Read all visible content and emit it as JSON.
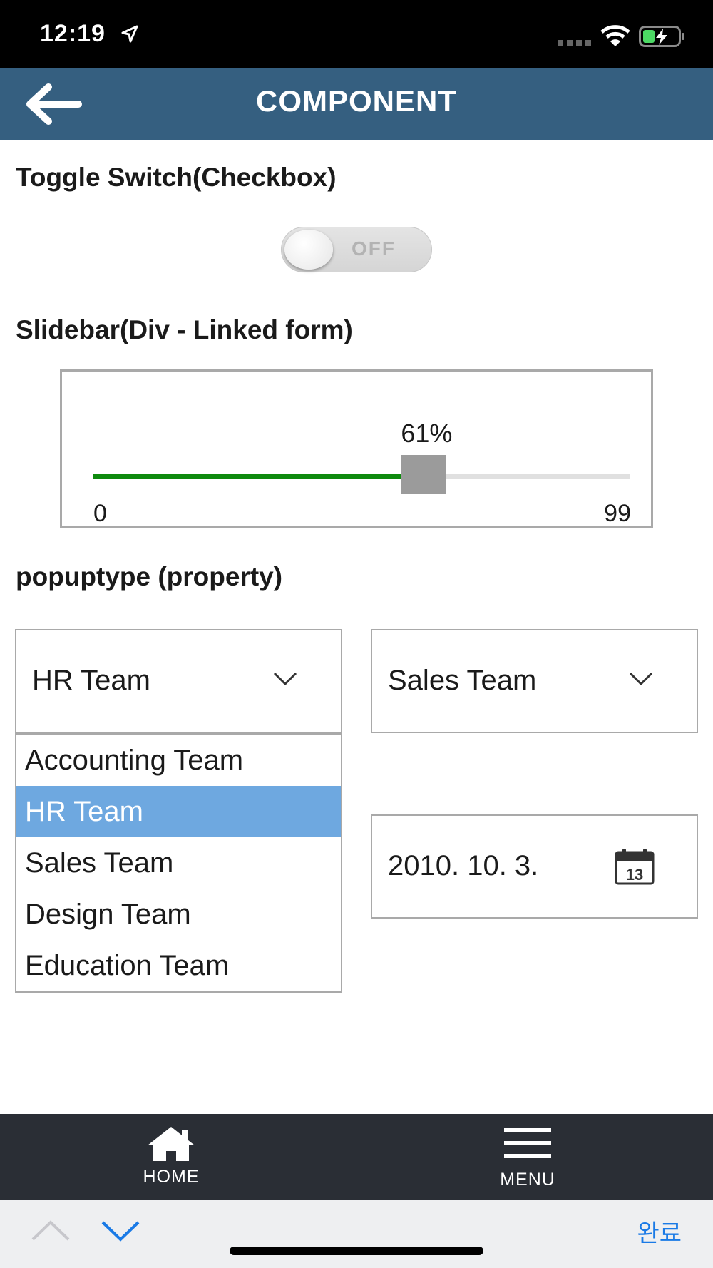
{
  "status_bar": {
    "time": "12:19"
  },
  "header": {
    "title": "COMPONENT",
    "back_icon": "arrow-left-icon"
  },
  "toggle_section": {
    "title": "Toggle Switch(Checkbox)",
    "toggle_label": "OFF",
    "is_on": false
  },
  "slider_section": {
    "title": "Slidebar(Div - Linked form)",
    "value_label": "61%",
    "value": 61,
    "min_label": "0",
    "max_label": "99",
    "min": 0,
    "max": 99,
    "fill_color": "#0e8a0e"
  },
  "popup_section": {
    "title": "popuptype (property)",
    "combo_left_value": "HR Team",
    "combo_right_value": "Sales Team",
    "dropdown_items": [
      "Accounting Team",
      "HR Team",
      "Sales Team",
      "Design Team",
      "Education Team"
    ],
    "selected_index": 1,
    "date_value": "2010. 10. 3.",
    "calendar_day": "13"
  },
  "bottom_nav": {
    "home_label": "HOME",
    "menu_label": "MENU"
  },
  "keyboard_accessory": {
    "done_label": "완료"
  },
  "colors": {
    "title_bar": "#355f80",
    "nav_bar": "#2a2e35",
    "selected_item": "#6ea8e0",
    "accent_link": "#1a7ae6"
  }
}
